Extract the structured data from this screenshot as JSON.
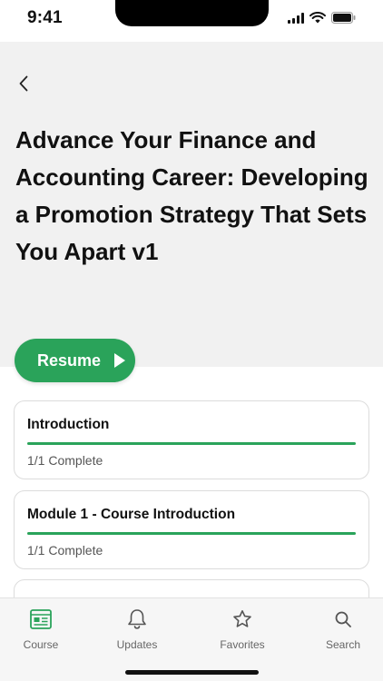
{
  "status_bar": {
    "time": "9:41"
  },
  "header": {
    "back_icon": "chevron-left-icon",
    "title": "Advance Your Finance and Accounting Career: Developing a Promotion Strategy That Sets You Apart v1"
  },
  "resume_button": {
    "label": "Resume",
    "icon": "play-icon"
  },
  "modules": [
    {
      "title": "Introduction",
      "status": "1/1 Complete",
      "progress": 1.0
    },
    {
      "title": "Module 1 - Course Introduction",
      "status": "1/1 Complete",
      "progress": 1.0
    }
  ],
  "tab_bar": {
    "tabs": [
      {
        "label": "Course",
        "icon": "course-icon"
      },
      {
        "label": "Updates",
        "icon": "bell-icon"
      },
      {
        "label": "Favorites",
        "icon": "star-icon"
      },
      {
        "label": "Search",
        "icon": "search-icon"
      }
    ]
  },
  "colors": {
    "accent": "#2aa35a",
    "header_bg": "#f1f1f1",
    "tab_bar_bg": "#f6f6f6"
  }
}
